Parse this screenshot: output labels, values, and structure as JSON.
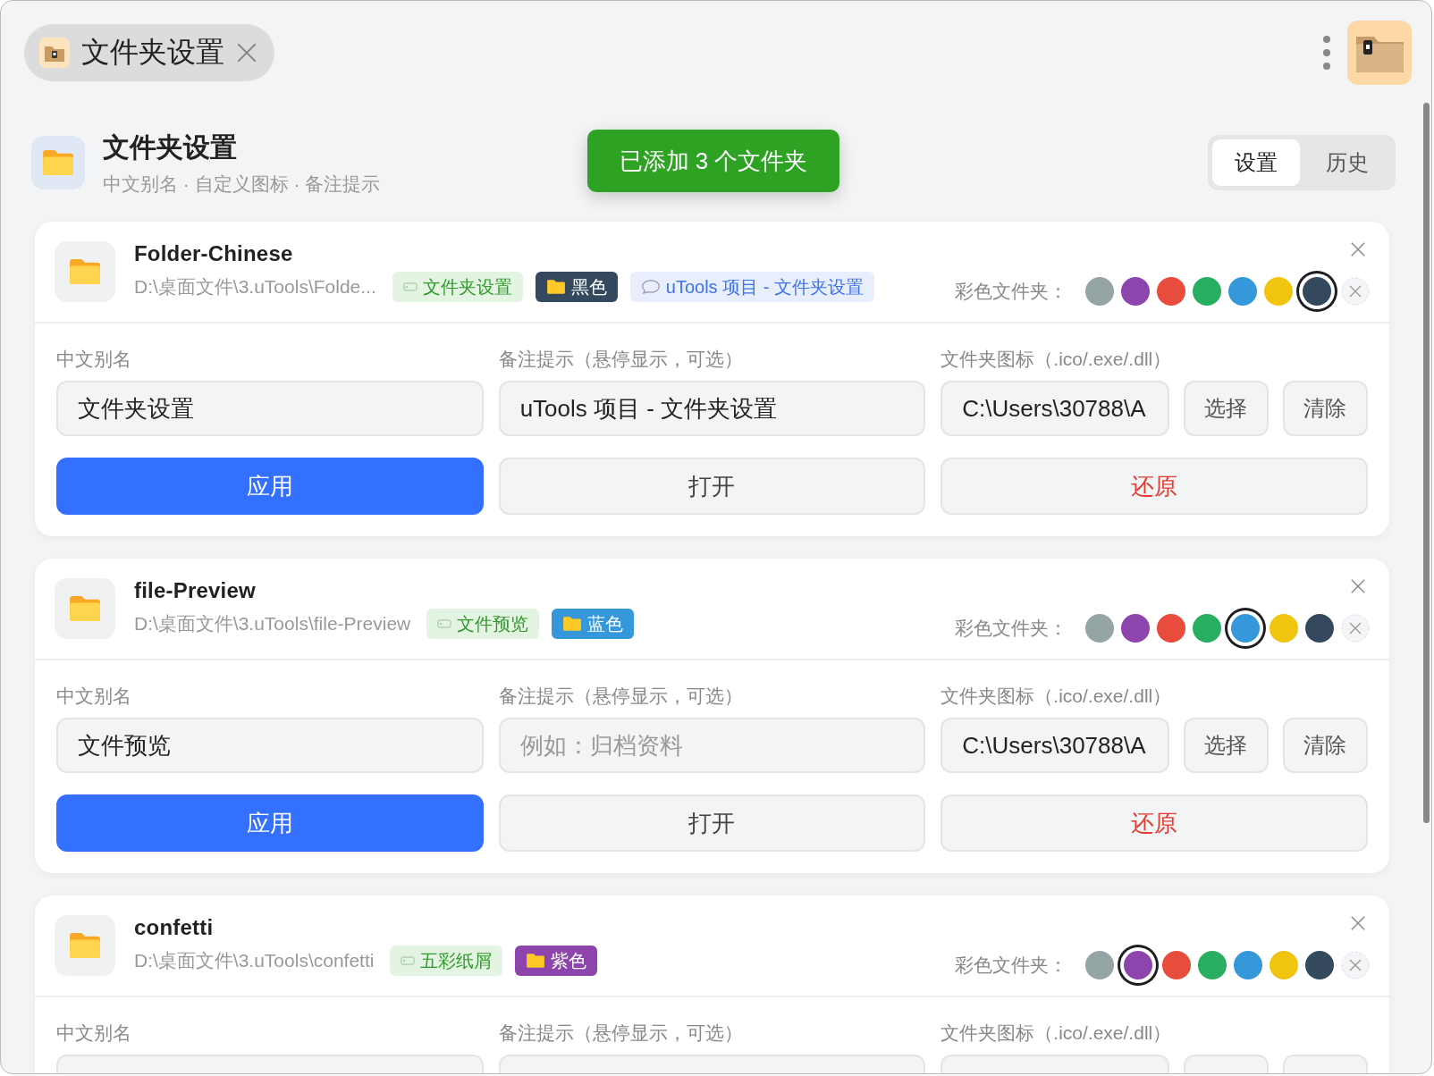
{
  "tab": {
    "title": "文件夹设置"
  },
  "header": {
    "title": "文件夹设置",
    "subtitle": "中文别名 · 自定义图标 · 备注提示"
  },
  "toast": "已添加 3 个文件夹",
  "views": [
    {
      "label": "设置",
      "selected": true
    },
    {
      "label": "历史",
      "selected": false
    }
  ],
  "folders": [
    {
      "name": "Folder-Chinese",
      "path": "D:\\桌面文件\\3.uTools\\Folde...",
      "tags": [
        {
          "kind": "alias",
          "label": "文件夹设置"
        },
        {
          "kind": "color",
          "label": "黑色",
          "color": "#34495e"
        },
        {
          "kind": "note",
          "label": "uTools 项目 - 文件夹设置"
        }
      ],
      "color_label": "彩色文件夹：",
      "swatches": [
        {
          "color": "#95a5a6",
          "selected": false
        },
        {
          "color": "#8e44ad",
          "selected": false
        },
        {
          "color": "#e74c3c",
          "selected": false
        },
        {
          "color": "#27ae60",
          "selected": false
        },
        {
          "color": "#3498db",
          "selected": false
        },
        {
          "color": "#f1c40f",
          "selected": false
        },
        {
          "color": "#34495e",
          "selected": true
        }
      ],
      "alias_label": "中文别名",
      "alias_value": "文件夹设置",
      "note_label": "备注提示（悬停显示，可选）",
      "note_value": "uTools 项目 - 文件夹设置",
      "icon_label": "文件夹图标（.ico/.exe/.dll）",
      "icon_value": "C:\\Users\\30788\\A",
      "choose": "选择",
      "clear": "清除",
      "apply": "应用",
      "open": "打开",
      "restore": "还原"
    },
    {
      "name": "file-Preview",
      "path": "D:\\桌面文件\\3.uTools\\file-Preview",
      "tags": [
        {
          "kind": "alias",
          "label": "文件预览"
        },
        {
          "kind": "color",
          "label": "蓝色",
          "color": "#3498db"
        }
      ],
      "color_label": "彩色文件夹：",
      "swatches": [
        {
          "color": "#95a5a6",
          "selected": false
        },
        {
          "color": "#8e44ad",
          "selected": false
        },
        {
          "color": "#e74c3c",
          "selected": false
        },
        {
          "color": "#27ae60",
          "selected": false
        },
        {
          "color": "#3498db",
          "selected": true
        },
        {
          "color": "#f1c40f",
          "selected": false
        },
        {
          "color": "#34495e",
          "selected": false
        }
      ],
      "alias_label": "中文别名",
      "alias_value": "文件预览",
      "note_label": "备注提示（悬停显示，可选）",
      "note_placeholder": "例如：归档资料",
      "icon_label": "文件夹图标（.ico/.exe/.dll）",
      "icon_value": "C:\\Users\\30788\\A",
      "choose": "选择",
      "clear": "清除",
      "apply": "应用",
      "open": "打开",
      "restore": "还原"
    },
    {
      "name": "confetti",
      "path": "D:\\桌面文件\\3.uTools\\confetti",
      "tags": [
        {
          "kind": "alias",
          "label": "五彩纸屑"
        },
        {
          "kind": "color",
          "label": "紫色",
          "color": "#8e44ad"
        }
      ],
      "color_label": "彩色文件夹：",
      "swatches": [
        {
          "color": "#95a5a6",
          "selected": false
        },
        {
          "color": "#8e44ad",
          "selected": true
        },
        {
          "color": "#e74c3c",
          "selected": false
        },
        {
          "color": "#27ae60",
          "selected": false
        },
        {
          "color": "#3498db",
          "selected": false
        },
        {
          "color": "#f1c40f",
          "selected": false
        },
        {
          "color": "#34495e",
          "selected": false
        }
      ],
      "alias_label": "中文别名",
      "note_label": "备注提示（悬停显示，可选）",
      "icon_label": "文件夹图标（.ico/.exe/.dll）"
    }
  ]
}
